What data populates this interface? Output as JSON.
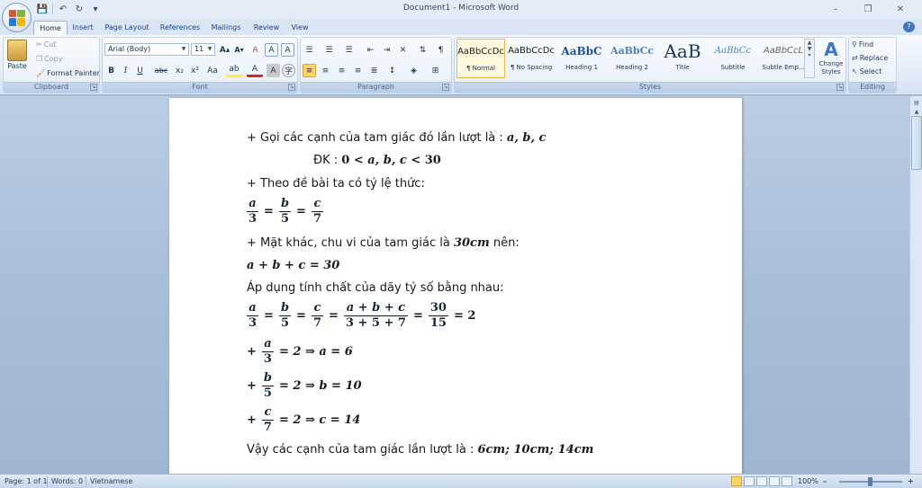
{
  "window": {
    "title": "Document1 - Microsoft Word"
  },
  "title_controls": {
    "minimize": "–",
    "maximize": "❐",
    "close": "✕"
  },
  "quick_access": {
    "save": "💾",
    "undo": "↶",
    "redo": "↻",
    "customize": "▾"
  },
  "tabs": [
    "Home",
    "Insert",
    "Page Layout",
    "References",
    "Mailings",
    "Review",
    "View"
  ],
  "ribbon": {
    "clipboard": {
      "label": "Clipboard",
      "paste": "Paste",
      "cut": "Cut",
      "copy": "Copy",
      "format_painter": "Format Painter"
    },
    "font": {
      "label": "Font",
      "font_name": "Arial (Body)",
      "font_size": "11",
      "bold": "B",
      "italic": "I",
      "underline": "U",
      "strike": "abc",
      "subscript": "x₂",
      "superscript": "x²",
      "case": "Aa",
      "grow": "A▴",
      "shrink": "A▾",
      "clear": "A",
      "highlight": "ab",
      "font_color": "A"
    },
    "paragraph": {
      "label": "Paragraph",
      "show_marks": "¶"
    },
    "styles": {
      "label": "Styles",
      "items": [
        {
          "sample": "AaBbCcDc",
          "name": "¶ Normal"
        },
        {
          "sample": "AaBbCcDc",
          "name": "¶ No Spacing"
        },
        {
          "sample": "AaBbC",
          "name": "Heading 1"
        },
        {
          "sample": "AaBbCc",
          "name": "Heading 2"
        },
        {
          "sample": "AaB",
          "name": "Title"
        },
        {
          "sample": "AaBbCc",
          "name": "Subtitle"
        },
        {
          "sample": "AaBbCcL",
          "name": "Subtle Emp..."
        }
      ],
      "change_styles": "Change Styles"
    },
    "editing": {
      "label": "Editing",
      "find": "Find",
      "replace": "Replace",
      "select": "Select"
    }
  },
  "document": {
    "l1_text": "+ Gọi các cạnh của tam giác đó lần lượt là : ",
    "l1_math": "a, b, c",
    "l2_text": "ĐK : ",
    "l2_math_a": "0 < ",
    "l2_math_b": "a, b, c",
    "l2_math_c": " < 30",
    "l3_text": "+ Theo đề bài ta có tỷ lệ thức:",
    "eq1": {
      "f1n": "a",
      "f1d": "3",
      "f2n": "b",
      "f2d": "5",
      "f3n": "c",
      "f3d": "7",
      "op": "="
    },
    "l4_text": "+ Mặt khác, chu vi của tam giác là ",
    "l4_math": "30cm",
    "l4_tail": " nên:",
    "l5_math": "a + b + c = 30",
    "l6_text": "Áp dụng tính chất của dãy tỷ số bằng nhau:",
    "eq2": {
      "f4n": "a + b + c",
      "f4d": "3 + 5 + 7",
      "f5n": "30",
      "f5d": "15",
      "result": "= 2"
    },
    "eq3": {
      "plus": "+",
      "num": "a",
      "den": "3",
      "rest": "= 2 ⇒ a = 6"
    },
    "eq4": {
      "plus": "+",
      "num": "b",
      "den": "5",
      "rest": "= 2 ⇒ b = 10"
    },
    "eq5": {
      "plus": "+",
      "num": "c",
      "den": "7",
      "rest": "= 2 ⇒ c = 14"
    },
    "l7_text": "Vậy các cạnh của tam giác lần lượt là : ",
    "l7_math": "6cm; 10cm; 14cm"
  },
  "status": {
    "page": "Page: 1 of 1",
    "words": "Words: 0",
    "language": "Vietnamese",
    "zoom": "100%",
    "zoom_out": "–",
    "zoom_in": "+"
  }
}
